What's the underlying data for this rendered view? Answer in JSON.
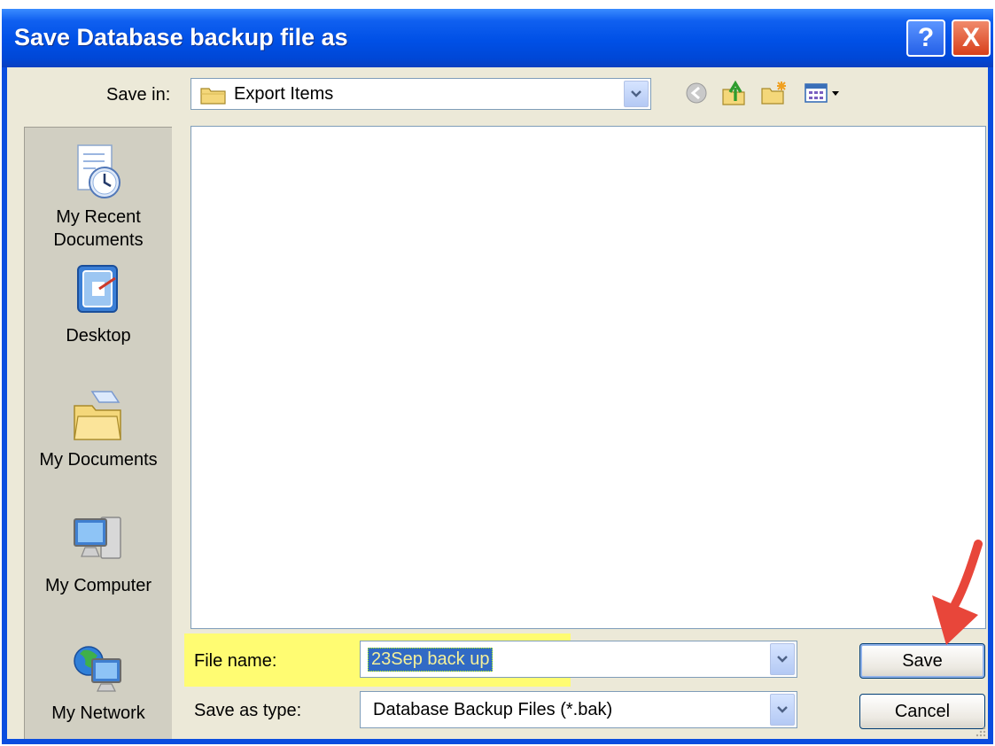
{
  "window": {
    "title": "Save Database backup file as",
    "help_label": "?",
    "close_label": "X"
  },
  "toolbar": {
    "save_in_label": "Save in:",
    "save_in_value": "Export Items",
    "icons": [
      "back-icon",
      "up-folder-icon",
      "new-folder-icon",
      "views-menu-icon"
    ]
  },
  "places": [
    {
      "label": "My Recent\nDocuments",
      "icon": "recent-documents-icon"
    },
    {
      "label": "Desktop",
      "icon": "desktop-icon"
    },
    {
      "label": "My Documents",
      "icon": "my-documents-icon"
    },
    {
      "label": "My Computer",
      "icon": "my-computer-icon"
    },
    {
      "label": "My Network",
      "icon": "my-network-icon"
    }
  ],
  "file_name": {
    "label": "File name:",
    "value": "23Sep back up"
  },
  "save_as_type": {
    "label": "Save as type:",
    "value": "Database Backup Files (*.bak)"
  },
  "buttons": {
    "save": "Save",
    "cancel": "Cancel"
  },
  "colors": {
    "titlebar": "#0050e6",
    "dialog_bg": "#ece9d8",
    "highlight": "#fffc72",
    "annotation_arrow": "#e8463a"
  }
}
